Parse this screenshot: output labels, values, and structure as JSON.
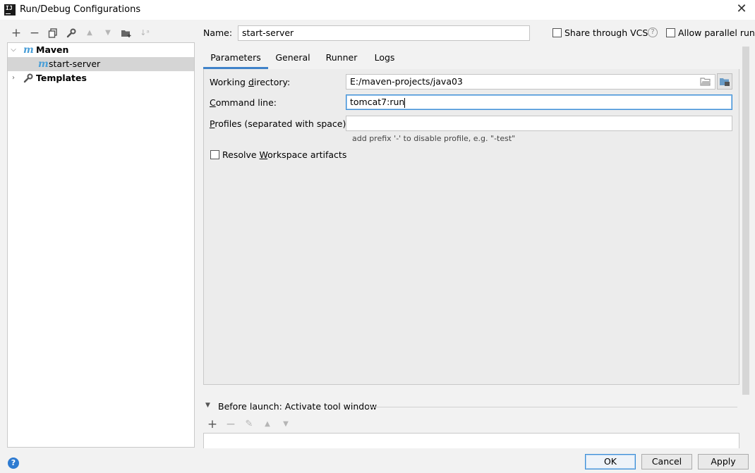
{
  "window": {
    "title": "Run/Debug Configurations",
    "app_icon_text": "IJ"
  },
  "left_toolbar": {
    "icons": [
      "add-icon",
      "remove-icon",
      "copy-icon",
      "wrench-icon",
      "move-up-icon",
      "move-down-icon",
      "new-folder-icon",
      "sort-icon"
    ]
  },
  "tree": {
    "maven_label": "Maven",
    "maven_icon_text": "m",
    "config_label": "start-server",
    "templates_label": "Templates"
  },
  "form": {
    "name_label": "Name:",
    "name_value": "start-server",
    "share_vcs_label": "Share through VCS",
    "allow_parallel_label": "Allow parallel run",
    "help_glyph": "?"
  },
  "tabs": [
    "Parameters",
    "General",
    "Runner",
    "Logs"
  ],
  "parameters": {
    "working_dir_label": "Working directory:",
    "working_dir_value": "E:/maven-projects/java03",
    "command_line_label": "Command line:",
    "command_line_value": "tomcat7:run",
    "profiles_label": "Profiles (separated with space):",
    "profiles_value": "",
    "profiles_hint": "add prefix '-' to disable profile, e.g. \"-test\"",
    "resolve_workspace_label": "Resolve Workspace artifacts"
  },
  "before_launch": {
    "title": "Before launch: Activate tool window"
  },
  "buttons": {
    "ok": "OK",
    "cancel": "Cancel",
    "apply": "Apply",
    "help": "?"
  }
}
